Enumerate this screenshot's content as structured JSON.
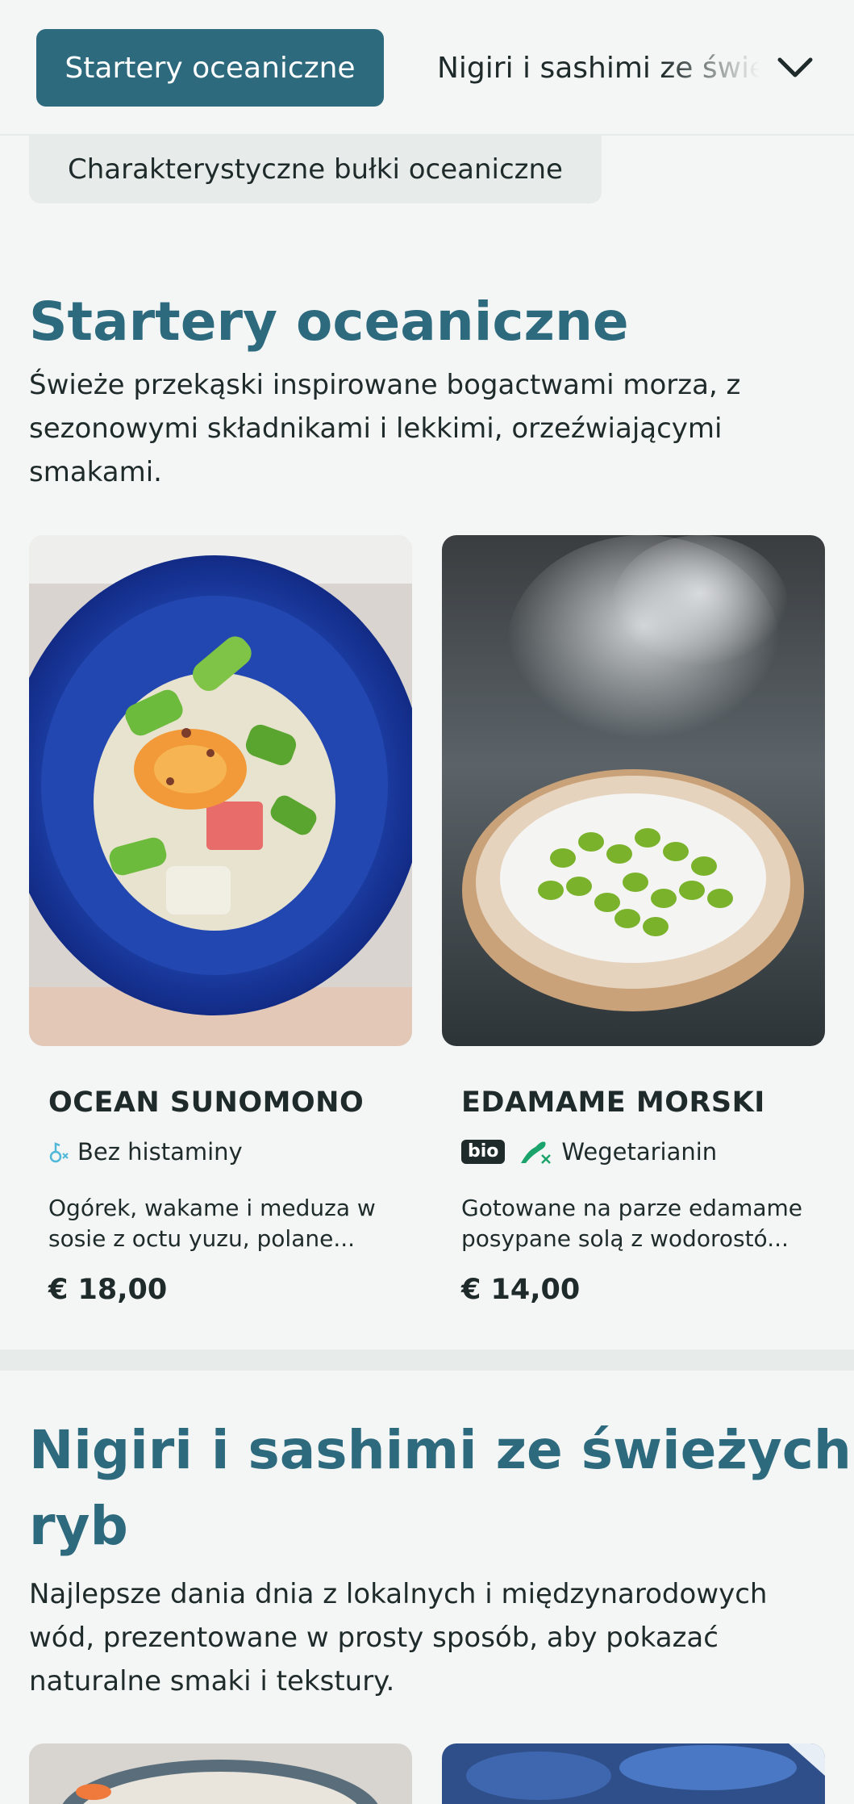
{
  "category_nav": {
    "active": "Startery oceaniczne",
    "next": "Nigiri i sashimi ze świeżych ryb",
    "more_icon": "chevron-down-icon",
    "second_row": "Charakterystyczne bułki oceaniczne"
  },
  "sections": [
    {
      "title": "Startery oceaniczne",
      "description": "Świeże przekąski inspirowane bogactwami morza, z sezonowymi składnikami i lekkimi, orzeźwiającymi smakami.",
      "items": [
        {
          "name": "OCEAN SUNOMONO",
          "tag": "Bez histaminy",
          "tag_icon": "histamine-free-icon",
          "description": "Ogórek, wakame i meduza w sosie z octu yuzu, polane...",
          "price": "€ 18,00"
        },
        {
          "name": "EDAMAME MORSKI",
          "badge": "bio",
          "tag": "Wegetarianin",
          "tag_icon": "vegetarian-icon",
          "description": "Gotowane na parze edamame posypane solą z wodorostó...",
          "price": "€ 14,00"
        }
      ]
    },
    {
      "title_line1": "Nigiri i sashimi ze świeżych",
      "title_line2": "ryb",
      "description": "Najlepsze dania dnia z lokalnych i międzynarodowych wód, prezentowane w prosty sposób, aby pokazać naturalne smaki i tekstury."
    }
  ],
  "colors": {
    "accent": "#2e6a7e",
    "background": "#f3f6f4",
    "text": "#1f2a2a",
    "veg_green": "#1aa36b",
    "histamine_blue": "#4fb7d8"
  }
}
